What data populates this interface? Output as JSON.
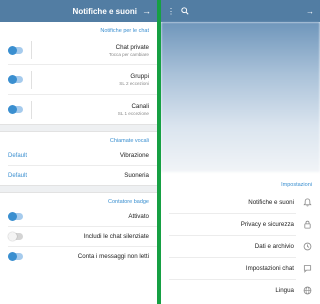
{
  "left_panel": {
    "title": "Notifiche e suoni",
    "sections": [
      {
        "header": "Notifiche per le chat",
        "rows": [
          {
            "title": "Chat private",
            "subtitle": "Tocca per cambiare",
            "toggle": "on"
          },
          {
            "title": "Gruppi",
            "subtitle": "SL 2 eccezioni",
            "toggle": "on"
          },
          {
            "title": "Canali",
            "subtitle": "SL 1 eccezione",
            "toggle": "on"
          }
        ]
      },
      {
        "header": "Chiamate vocali",
        "rows": [
          {
            "title": "Vibrazione",
            "value": "Default"
          },
          {
            "title": "Suoneria",
            "value": "Default"
          }
        ]
      },
      {
        "header": "Contatore badge",
        "rows": [
          {
            "title": "Attivato",
            "toggle": "on"
          },
          {
            "title": "Includi le chat silenziate",
            "toggle": "off"
          },
          {
            "title": "Conta i messaggi non letti",
            "toggle": "on"
          }
        ]
      }
    ]
  },
  "right_panel": {
    "section_header": "Impostazioni",
    "items": [
      {
        "label": "Notifiche e suoni",
        "icon": "bell-icon"
      },
      {
        "label": "Privacy e sicurezza",
        "icon": "lock-icon"
      },
      {
        "label": "Dati e archivio",
        "icon": "clock-icon"
      },
      {
        "label": "Impostazioni chat",
        "icon": "chat-bubble-icon"
      },
      {
        "label": "Lingua",
        "icon": "globe-icon"
      }
    ]
  },
  "colors": {
    "header": "#527da3",
    "accent": "#3a8fd0",
    "separator": "#16a043"
  }
}
